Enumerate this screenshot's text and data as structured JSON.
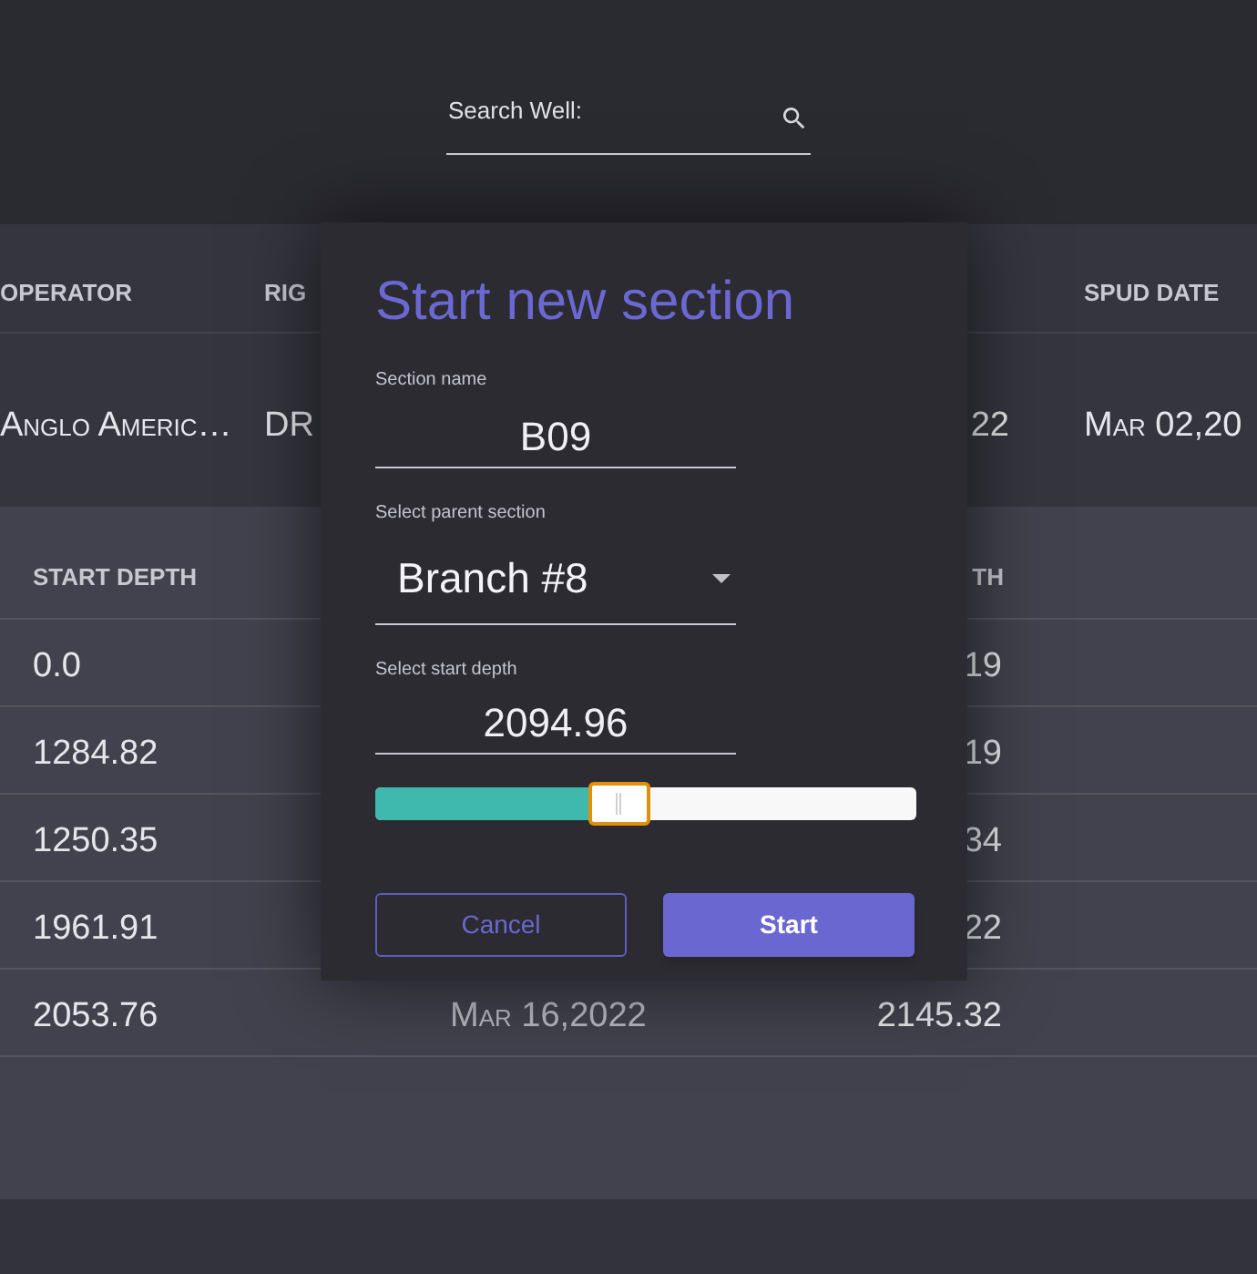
{
  "search": {
    "label": "Search Well:"
  },
  "wells_table": {
    "columns": [
      "OPERATOR",
      "RIG",
      "SPUD DATE"
    ],
    "rows": [
      {
        "operator": "Anglo Americ…",
        "rig": "DR",
        "column_3": "22",
        "spud_date": "Mar 02,20"
      }
    ]
  },
  "sections_table": {
    "columns": [
      "START DEPTH",
      "TH"
    ],
    "rows": [
      {
        "start_depth": "0.0",
        "column_3": "19"
      },
      {
        "start_depth": "1284.82",
        "column_3": "19"
      },
      {
        "start_depth": "1250.35",
        "column_3": "34"
      },
      {
        "start_depth": "1961.91",
        "column_3": "22"
      },
      {
        "start_depth": "2053.76",
        "column_2": "Mar 16,2022",
        "column_3": "2145.32"
      }
    ]
  },
  "dialog": {
    "title": "Start new section",
    "section_name": {
      "label": "Section name",
      "value": "B09"
    },
    "parent_section": {
      "label": "Select parent section",
      "value": "Branch #8"
    },
    "start_depth": {
      "label": "Select start depth",
      "value": "2094.96",
      "level": 0.45
    },
    "buttons": [
      {
        "label": "Cancel",
        "kind": "outline"
      },
      {
        "label": "Start",
        "kind": "primary"
      }
    ]
  }
}
